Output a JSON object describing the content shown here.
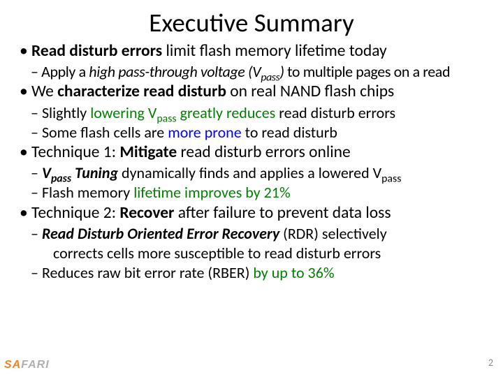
{
  "title": "Executive Summary",
  "p1_a": "Read disturb errors",
  "p1_b": " limit flash memory lifetime today",
  "p2_a": "Apply a ",
  "p2_b": "high pass-through voltage (V",
  "p2_c": "pass",
  "p2_d": ")",
  "p2_e": " to multiple pages on a read",
  "p3_a": "We ",
  "p3_b": "characterize read disturb",
  "p3_c": " on real NAND flash chips",
  "p4_a": "Slightly ",
  "p4_b": "lowering V",
  "p4_c": "pass",
  "p4_d": " greatly reduces",
  "p4_e": " read disturb errors",
  "p5_a": "Some flash cells are ",
  "p5_b": "more prone",
  "p5_c": " to read disturb",
  "p6_a": "Technique 1: ",
  "p6_b": "Mitigate",
  "p6_c": " read disturb errors online",
  "p7_a": "V",
  "p7_b": "pass",
  "p7_c": " Tuning",
  "p7_d": " dynamically finds and applies a lowered V",
  "p7_e": "pass",
  "p8_a": "Flash memory ",
  "p8_b": "lifetime improves by 21%",
  "p9_a": "Technique 2: ",
  "p9_b": "Recover",
  "p9_c": " after failure to prevent data loss",
  "p10_a": "Read Disturb Oriented Error Recovery",
  "p10_b": " (RDR) selectively",
  "p10_c": "corrects cells more susceptible to read disturb errors",
  "p11_a": "Reduces raw bit error rate (RBER) ",
  "p11_b": "by up to 36%",
  "logo_a": "SA",
  "logo_b": "FARI",
  "page": "2"
}
